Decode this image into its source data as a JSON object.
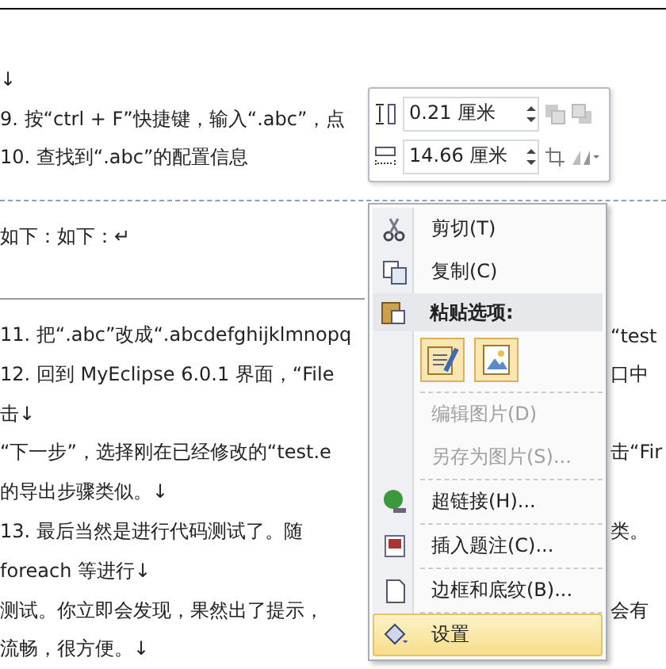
{
  "document": {
    "lines": [
      {
        "kind": "text",
        "left": "↓"
      },
      {
        "kind": "text",
        "left": "9. 按“ctrl + F”快捷键，输入“.abc”，点"
      },
      {
        "kind": "text",
        "left": "10. 查找到“.abc”的配置信息"
      },
      {
        "kind": "dashed-rule"
      },
      {
        "kind": "text",
        "left": "如下：如下：↵"
      },
      {
        "kind": "rule"
      },
      {
        "kind": "text",
        "left": "11. 把“.abc”改成“.abcdefghijklmnopq",
        "right": "“test"
      },
      {
        "kind": "text",
        "left": "12. 回到 MyEclipse  6.0.1 界面，“File",
        "right": "口中"
      },
      {
        "kind": "text",
        "left": "击↓"
      },
      {
        "kind": "text",
        "left": "“下一步”，选择刚在已经修改的“test.e",
        "right": "击“Fir"
      },
      {
        "kind": "text",
        "left": "的导出步骤类似。↓"
      },
      {
        "kind": "text",
        "left": "13. 最后当然是进行代码测试了。随",
        "right": "类。"
      },
      {
        "kind": "text",
        "left": "foreach 等进行↓"
      },
      {
        "kind": "text",
        "left": "测试。你立即会发现，果然出了提示，",
        "right": "会有"
      },
      {
        "kind": "text",
        "left": "流畅，很方便。↓"
      }
    ]
  },
  "mini_toolbar": {
    "rows": [
      {
        "value": "0.21 厘米"
      },
      {
        "value": "14.66 厘米"
      }
    ]
  },
  "context_menu": {
    "items": [
      {
        "kind": "command",
        "label": "剪切(T)",
        "disabled": false,
        "highlighted": false
      },
      {
        "kind": "command",
        "label": "复制(C)",
        "disabled": false,
        "highlighted": false
      },
      {
        "kind": "header",
        "label": "粘贴选项:"
      },
      {
        "kind": "paste-icons"
      },
      {
        "kind": "separator"
      },
      {
        "kind": "command",
        "label": "编辑图片(D)",
        "disabled": true,
        "highlighted": false
      },
      {
        "kind": "command",
        "label": "另存为图片(S)...",
        "disabled": true,
        "highlighted": false
      },
      {
        "kind": "separator"
      },
      {
        "kind": "command",
        "label": "超链接(H)...",
        "disabled": false,
        "highlighted": false
      },
      {
        "kind": "separator"
      },
      {
        "kind": "command",
        "label": "插入题注(C)...",
        "disabled": false,
        "highlighted": false
      },
      {
        "kind": "separator"
      },
      {
        "kind": "command",
        "label": "边框和底纹(B)...",
        "disabled": false,
        "highlighted": false
      },
      {
        "kind": "separator"
      },
      {
        "kind": "command",
        "label": "设置",
        "disabled": false,
        "highlighted": true
      }
    ]
  }
}
